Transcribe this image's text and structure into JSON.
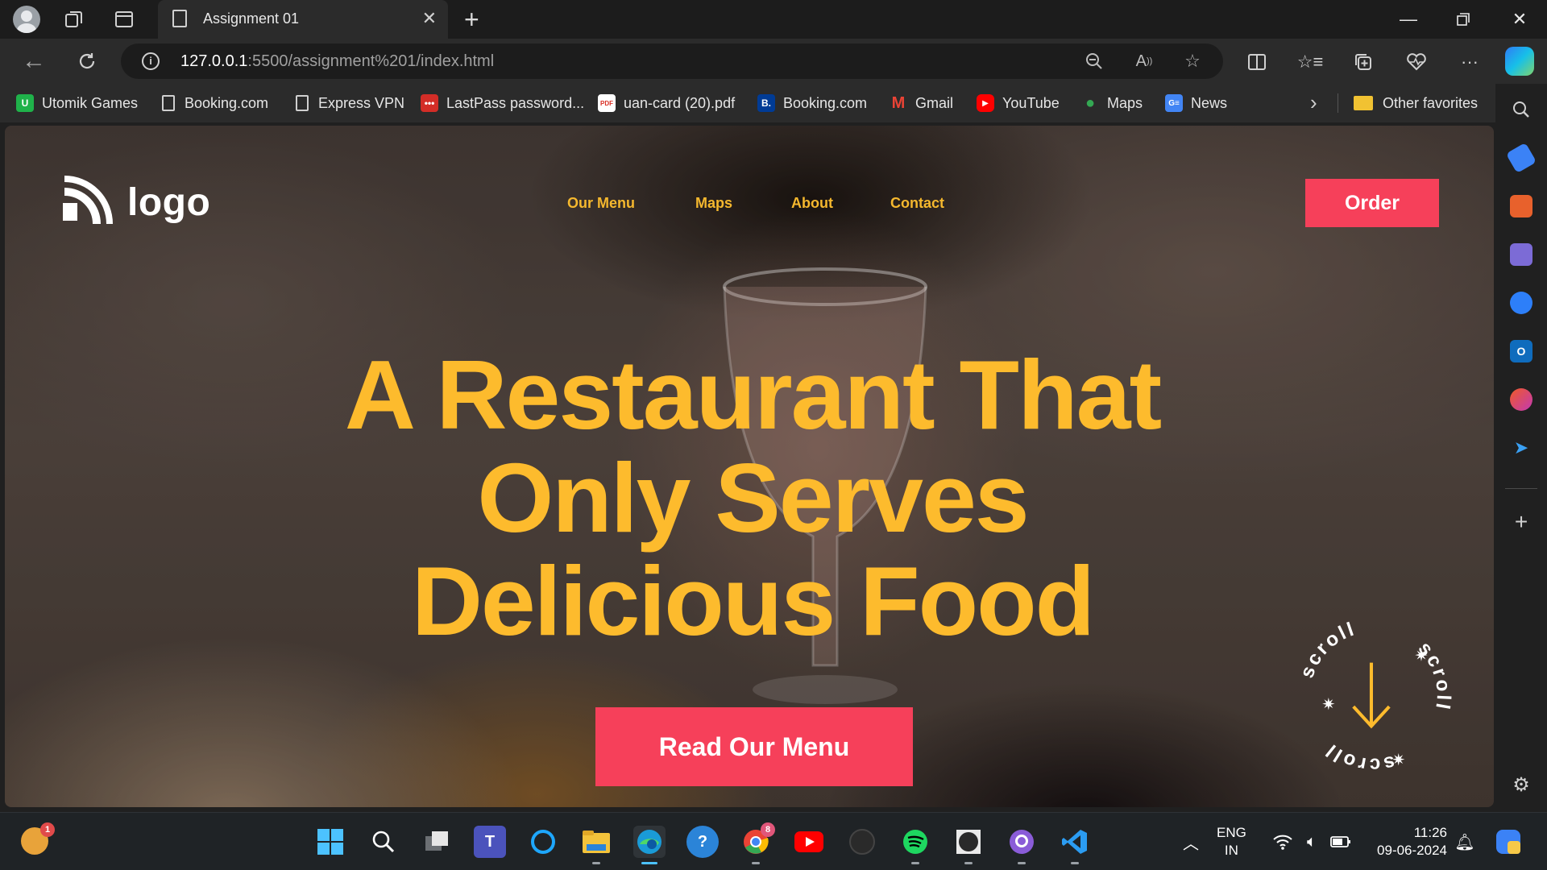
{
  "browser": {
    "tab_title": "Assignment 01",
    "url_host": "127.0.0.1",
    "url_path": ":5500/assignment%201/index.html"
  },
  "favorites": [
    {
      "label": "Utomik Games",
      "icon": "utomik-icon"
    },
    {
      "label": "Booking.com",
      "icon": "page-icon"
    },
    {
      "label": "Express VPN",
      "icon": "page-icon"
    },
    {
      "label": "LastPass password...",
      "icon": "lastpass-icon"
    },
    {
      "label": "uan-card (20).pdf",
      "icon": "pdf-icon"
    },
    {
      "label": "Booking.com",
      "icon": "booking-icon"
    },
    {
      "label": "Gmail",
      "icon": "gmail-icon"
    },
    {
      "label": "YouTube",
      "icon": "youtube-icon"
    },
    {
      "label": "Maps",
      "icon": "maps-icon"
    },
    {
      "label": "News",
      "icon": "news-icon"
    }
  ],
  "other_favorites": "Other favorites",
  "site": {
    "logo_text": "logo",
    "nav": [
      "Our Menu",
      "Maps",
      "About",
      "Contact"
    ],
    "order_label": "Order",
    "hero_lines": [
      "A Restaurant That",
      "Only Serves",
      "Delicious Food"
    ],
    "cta_label": "Read Our Menu",
    "scroll_text": "scroll",
    "colors": {
      "accent": "#f6405a",
      "headline": "#fdbb2d",
      "nav": "#f5b82e"
    }
  },
  "taskbar": {
    "notification_count": "1",
    "chrome_badge": "8",
    "language_top": "ENG",
    "language_bottom": "IN",
    "time": "11:26",
    "date": "09-06-2024"
  }
}
